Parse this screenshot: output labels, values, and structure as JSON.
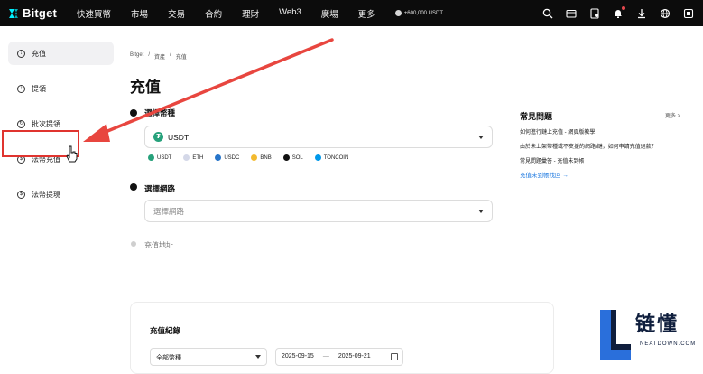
{
  "brand": {
    "name": "Bitget",
    "accent": "#00f0ff"
  },
  "nav": {
    "items": [
      "快速買幣",
      "市場",
      "交易",
      "合約",
      "理財",
      "Web3",
      "廣場",
      "更多"
    ]
  },
  "promo": {
    "text": "+600,000 USDT"
  },
  "top_icons": [
    "search-icon",
    "wallet-icon",
    "orders-icon",
    "bell-icon",
    "download-icon",
    "globe-icon",
    "theme-icon"
  ],
  "sidebar": {
    "items": [
      {
        "label": "充值",
        "icon": "deposit-icon",
        "active": true
      },
      {
        "label": "提領",
        "icon": "withdraw-icon",
        "active": false
      },
      {
        "label": "批次提領",
        "icon": "batch-withdraw-icon",
        "active": false
      },
      {
        "label": "法幣充值",
        "icon": "fiat-deposit-icon",
        "active": false
      },
      {
        "label": "法幣提現",
        "icon": "fiat-withdraw-icon",
        "active": false
      }
    ]
  },
  "breadcrumb": [
    "Bitget",
    "/",
    "資產",
    "/",
    "充值"
  ],
  "page": {
    "title": "充值"
  },
  "steps": {
    "coin_label": "選擇幣種",
    "coin_value": "USDT",
    "network_label": "選擇網路",
    "network_placeholder": "選擇網路",
    "address_label": "充值地址"
  },
  "coins": [
    {
      "name": "USDT",
      "color": "#26a17b"
    },
    {
      "name": "ETH",
      "color": "#8a92b2"
    },
    {
      "name": "USDC",
      "color": "#2775ca"
    },
    {
      "name": "BNB",
      "color": "#f3ba2f"
    },
    {
      "name": "SOL",
      "color": "#111111"
    },
    {
      "name": "TONCOIN",
      "color": "#0098ea"
    }
  ],
  "faq": {
    "title": "常見問題",
    "more": "更多 >",
    "items": [
      "如何進行鏈上充值 - 網頁版教學",
      "由於未上架幣種或不支援的網路/鏈，如何申請充值退款？",
      "常見問題彙答 - 充值未到帳"
    ],
    "link": "充值未到帳找回 →"
  },
  "records": {
    "title": "充值紀錄",
    "filter": "全部幣種",
    "date_from": "2025-09-15",
    "date_sep": "—",
    "date_to": "2025-09-21"
  },
  "watermark": {
    "main": "链懂",
    "sub": "NEATDOWN.COM"
  }
}
